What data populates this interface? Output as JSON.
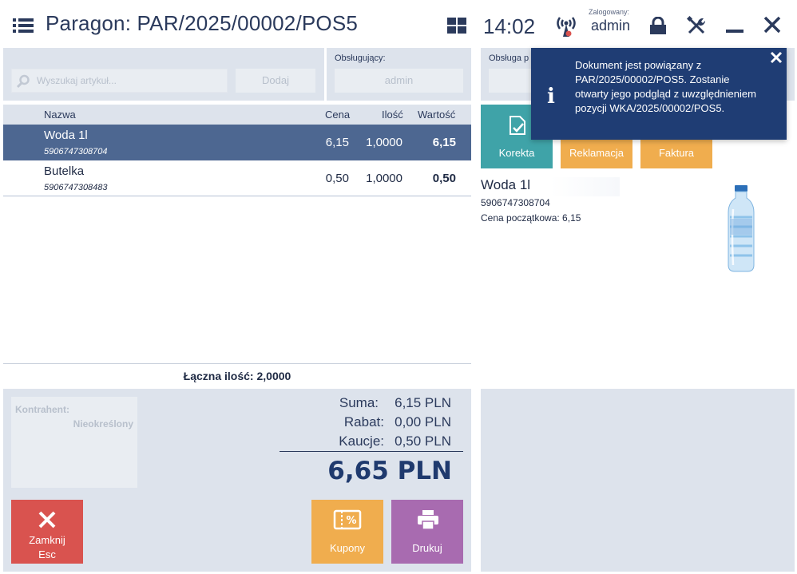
{
  "header": {
    "title": "Paragon: PAR/2025/00002/POS5",
    "time": "14:02",
    "login_label": "Zalogowany:",
    "login_user": "admin"
  },
  "search": {
    "placeholder": "Wyszukaj artykuł...",
    "add_label": "Dodaj"
  },
  "servicer": {
    "label": "Obsługujący:",
    "value": "admin",
    "right_label": "Obsługa p"
  },
  "table": {
    "columns": [
      "Nazwa",
      "Cena",
      "Ilość",
      "Wartość"
    ],
    "rows": [
      {
        "name": "Woda 1l",
        "code": "5906747308704",
        "price": "6,15",
        "qty": "1,0000",
        "value": "6,15"
      },
      {
        "name": "Butelka",
        "code": "5906747308483",
        "price": "0,50",
        "qty": "1,0000",
        "value": "0,50"
      }
    ],
    "total_qty_label": "Łączna ilość:",
    "total_qty_value": "2,0000"
  },
  "contractor": {
    "label": "Kontrahent:",
    "value": "Nieokreślony"
  },
  "summary": {
    "sum_label": "Suma:",
    "sum_value": "6,15 PLN",
    "discount_label": "Rabat:",
    "discount_value": "0,00 PLN",
    "deposit_label": "Kaucje:",
    "deposit_value": "0,50 PLN",
    "total": "6,65 PLN"
  },
  "buttons": {
    "close_label": "Zamknij",
    "close_shortcut": "Esc",
    "coupons_label": "Kupony",
    "print_label": "Drukuj",
    "correction_label": "Korekta",
    "complaint_label": "Reklamacja",
    "invoice_label": "Faktura"
  },
  "product": {
    "name": "Woda 1l",
    "code": "5906747308704",
    "price_text": "Cena początkowa: 6,15"
  },
  "notification": {
    "text": "Dokument jest powiązany z PAR/2025/00002/POS5. Zostanie otwarty jego podgląd z uwzględnieniem pozycji WKA/2025/00002/POS5."
  },
  "colors": {
    "accent": "#1f3d74",
    "selected_row": "#4d6791",
    "close_button": "#d9534f",
    "coupons_button": "#f0ad4e",
    "print_button": "#a86bb0",
    "correction_button": "#3fa3a8"
  },
  "icons": {
    "menu": "menu-icon",
    "tiles": "tiles-icon",
    "signal": "signal-icon",
    "lock": "lock-icon",
    "tools": "tools-icon",
    "minimize": "minimize-icon",
    "close": "close-icon",
    "search": "search-icon",
    "coupon": "coupon-icon",
    "printer": "printer-icon",
    "correction": "document-check-icon",
    "info": "info-icon"
  }
}
